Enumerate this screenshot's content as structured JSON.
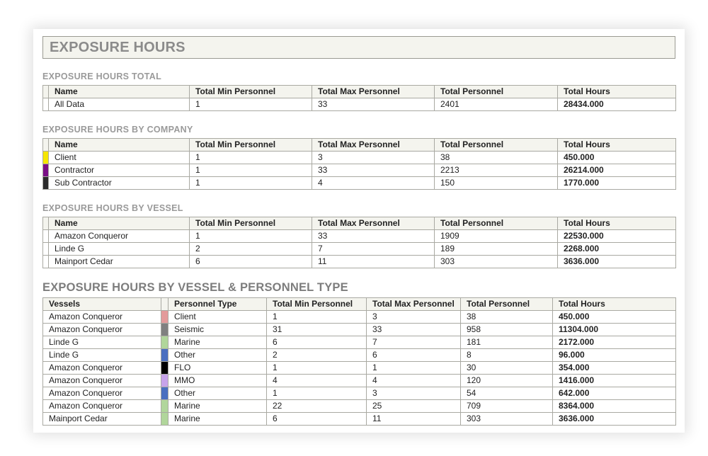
{
  "page_title": "EXPOSURE HOURS",
  "total": {
    "title": "EXPOSURE HOURS TOTAL",
    "headers": [
      "Name",
      "Total Min Personnel",
      "Total Max Personnel",
      "Total Personnel",
      "Total Hours"
    ],
    "rows": [
      {
        "name": "All Data",
        "min": "1",
        "max": "33",
        "personnel": "2401",
        "hours": "28434.000"
      }
    ]
  },
  "company": {
    "title": "EXPOSURE HOURS BY COMPANY",
    "headers": [
      "Name",
      "Total Min Personnel",
      "Total Max Personnel",
      "Total Personnel",
      "Total Hours"
    ],
    "rows": [
      {
        "color": "#f5e600",
        "name": "Client",
        "min": "1",
        "max": "3",
        "personnel": "38",
        "hours": "450.000"
      },
      {
        "color": "#7a0f86",
        "name": "Contractor",
        "min": "1",
        "max": "33",
        "personnel": "2213",
        "hours": "26214.000"
      },
      {
        "color": "#2b2b2b",
        "name": "Sub Contractor",
        "min": "1",
        "max": "4",
        "personnel": "150",
        "hours": "1770.000"
      }
    ]
  },
  "vessel": {
    "title": "EXPOSURE HOURS BY VESSEL",
    "headers": [
      "Name",
      "Total Min Personnel",
      "Total Max Personnel",
      "Total Personnel",
      "Total Hours"
    ],
    "rows": [
      {
        "name": "Amazon Conqueror",
        "min": "1",
        "max": "33",
        "personnel": "1909",
        "hours": "22530.000"
      },
      {
        "name": "Linde G",
        "min": "2",
        "max": "7",
        "personnel": "189",
        "hours": "2268.000"
      },
      {
        "name": "Mainport Cedar",
        "min": "6",
        "max": "11",
        "personnel": "303",
        "hours": "3636.000"
      }
    ]
  },
  "vessel_type": {
    "title": "EXPOSURE HOURS BY VESSEL & PERSONNEL TYPE",
    "headers": [
      "Vessels",
      "Personnel Type",
      "Total Min Personnel",
      "Total Max Personnel",
      "Total Personnel",
      "Total Hours"
    ],
    "rows": [
      {
        "vessel": "Amazon Conqueror",
        "color": "#e39a9a",
        "type": "Client",
        "min": "1",
        "max": "3",
        "personnel": "38",
        "hours": "450.000"
      },
      {
        "vessel": "Amazon Conqueror",
        "color": "#808080",
        "type": "Seismic",
        "min": "31",
        "max": "33",
        "personnel": "958",
        "hours": "11304.000"
      },
      {
        "vessel": "Linde G",
        "color": "#b1d69b",
        "type": "Marine",
        "min": "6",
        "max": "7",
        "personnel": "181",
        "hours": "2172.000"
      },
      {
        "vessel": "Linde G",
        "color": "#4a6fc0",
        "type": "Other",
        "min": "2",
        "max": "6",
        "personnel": "8",
        "hours": "96.000"
      },
      {
        "vessel": "Amazon Conqueror",
        "color": "#000000",
        "type": "FLO",
        "min": "1",
        "max": "1",
        "personnel": "30",
        "hours": "354.000"
      },
      {
        "vessel": "Amazon Conqueror",
        "color": "#c7a3ea",
        "type": "MMO",
        "min": "4",
        "max": "4",
        "personnel": "120",
        "hours": "1416.000"
      },
      {
        "vessel": "Amazon Conqueror",
        "color": "#4a6fc0",
        "type": "Other",
        "min": "1",
        "max": "3",
        "personnel": "54",
        "hours": "642.000"
      },
      {
        "vessel": "Amazon Conqueror",
        "color": "#b1d69b",
        "type": "Marine",
        "min": "22",
        "max": "25",
        "personnel": "709",
        "hours": "8364.000"
      },
      {
        "vessel": "Mainport Cedar",
        "color": "#b1d69b",
        "type": "Marine",
        "min": "6",
        "max": "11",
        "personnel": "303",
        "hours": "3636.000"
      }
    ]
  }
}
